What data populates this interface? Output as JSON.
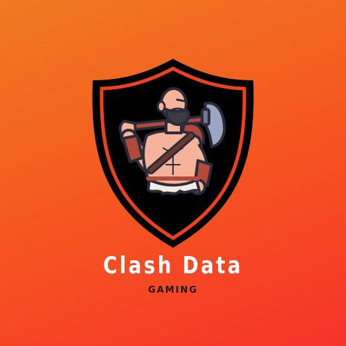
{
  "brand": {
    "name": "Clash Data",
    "tagline": "GAMING"
  },
  "logo": {
    "icon": "barbarian-warrior-icon",
    "shield_icon": "shield-icon",
    "axe_icon": "axe-icon"
  },
  "colors": {
    "background_top": "#f07a22",
    "background_bottom": "#f6332a",
    "shield_fill": "#000000",
    "shield_border": "#f0401e",
    "skin": "#f4b39a",
    "outline": "#2b2b3a",
    "beard": "#3b3b45",
    "armor": "#b04a3a",
    "cloth": "#f0ece6",
    "axe_blade": "#9aa6c2",
    "text_primary": "#ffffff",
    "text_secondary": "#1a1a1a"
  }
}
